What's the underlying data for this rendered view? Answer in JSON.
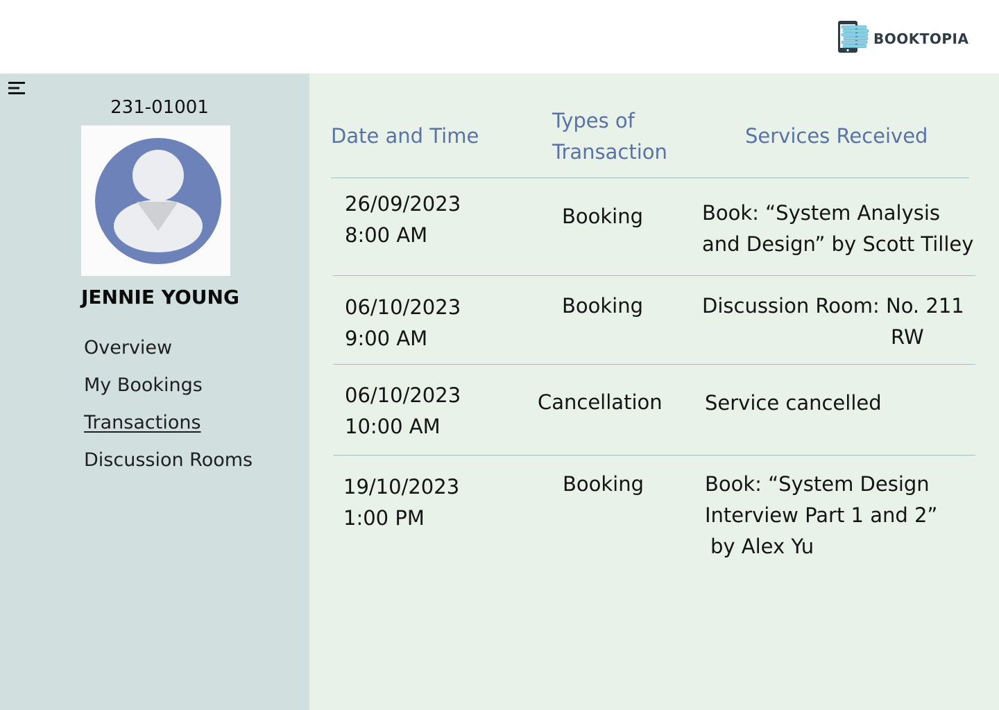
{
  "brand": {
    "name": "BOOKTOPIA"
  },
  "profile": {
    "id": "231-01001",
    "name": "JENNIE YOUNG"
  },
  "nav": {
    "items": [
      {
        "label": "Overview"
      },
      {
        "label": "My Bookings"
      },
      {
        "label": "Transactions"
      },
      {
        "label": "Discussion Rooms"
      }
    ],
    "active": "Transactions"
  },
  "table": {
    "headers": {
      "date": "Date and Time",
      "type": "Types of Transaction",
      "services": "Services Received"
    },
    "rows": [
      {
        "date": "26/09/2023",
        "time": "8:00 AM",
        "type": "Booking",
        "service_line1": "Book: “System Analysis",
        "service_line2": "and Design” by Scott Tilley",
        "service_line3": ""
      },
      {
        "date": "06/10/2023",
        "time": "9:00 AM",
        "type": "Booking",
        "service_line1": "Discussion Room: No. 211",
        "service_line2": "RW",
        "service_line3": ""
      },
      {
        "date": "06/10/2023",
        "time": "10:00 AM",
        "type": "Cancellation",
        "service_line1": "Service cancelled",
        "service_line2": "",
        "service_line3": ""
      },
      {
        "date": "19/10/2023",
        "time": "1:00 PM",
        "type": "Booking",
        "service_line1": "Book: “System Design",
        "service_line2": "Interview Part 1 and 2”",
        "service_line3": "by Alex Yu"
      }
    ]
  },
  "icons": {
    "menu": "hamburger-menu-icon",
    "logo": "book-tablet-logo-icon",
    "avatar": "user-avatar-icon"
  },
  "colors": {
    "sidebar_bg": "#d1e0de",
    "main_bg": "#e8f2e8",
    "header_text": "#5a73a6",
    "avatar": "#6c82b8",
    "divider": "#9cc2cc"
  }
}
